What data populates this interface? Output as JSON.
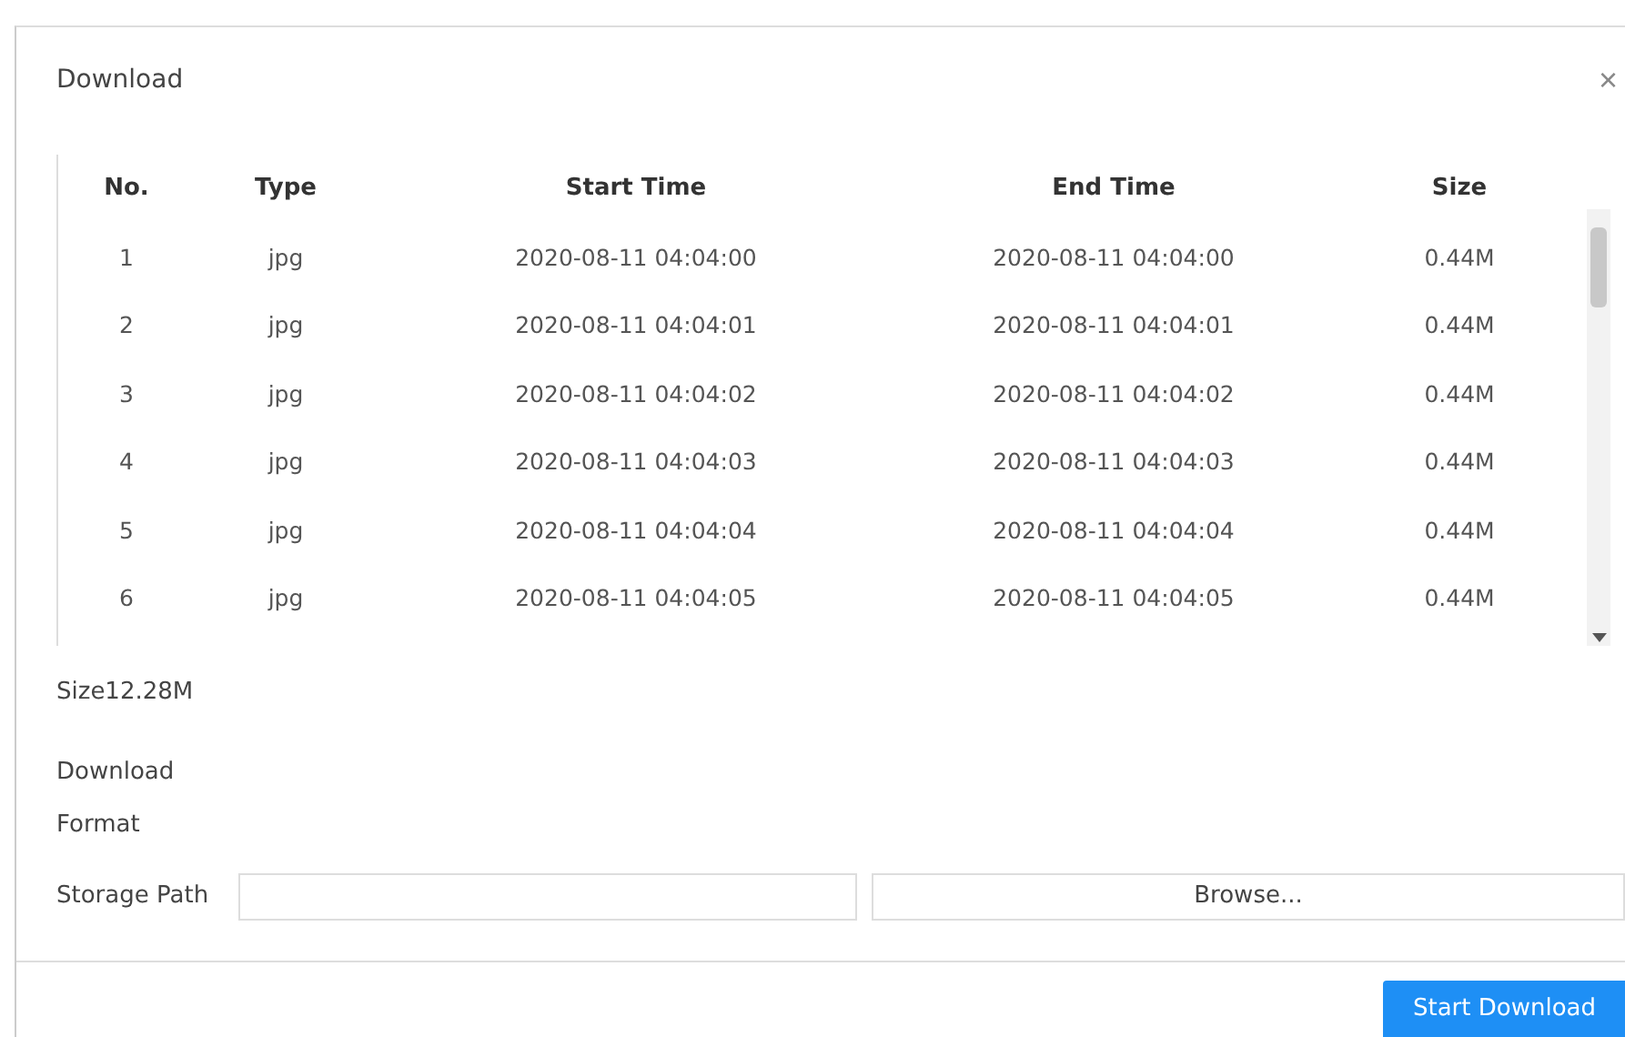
{
  "window": {
    "title": "Download",
    "close": "×"
  },
  "table": {
    "columns": [
      "No.",
      "Type",
      "Start Time",
      "End Time",
      "Size"
    ],
    "rows": [
      [
        "1",
        "jpg",
        "2020-08-11 04:04:00",
        "2020-08-11 04:04:00",
        "0.44M"
      ],
      [
        "2",
        "jpg",
        "2020-08-11 04:04:01",
        "2020-08-11 04:04:01",
        "0.44M"
      ],
      [
        "3",
        "jpg",
        "2020-08-11 04:04:02",
        "2020-08-11 04:04:02",
        "0.44M"
      ],
      [
        "4",
        "jpg",
        "2020-08-11 04:04:03",
        "2020-08-11 04:04:03",
        "0.44M"
      ],
      [
        "5",
        "jpg",
        "2020-08-11 04:04:04",
        "2020-08-11 04:04:04",
        "0.44M"
      ],
      [
        "6",
        "jpg",
        "2020-08-11 04:04:05",
        "2020-08-11 04:04:05",
        "0.44M"
      ]
    ]
  },
  "total_size": "Size12.28M",
  "form": {
    "download_format_label": "Download\nFormat",
    "storage_path_label": "Storage Path",
    "browse_button": "Browse..."
  },
  "buttons": {
    "start": "Start Download"
  }
}
